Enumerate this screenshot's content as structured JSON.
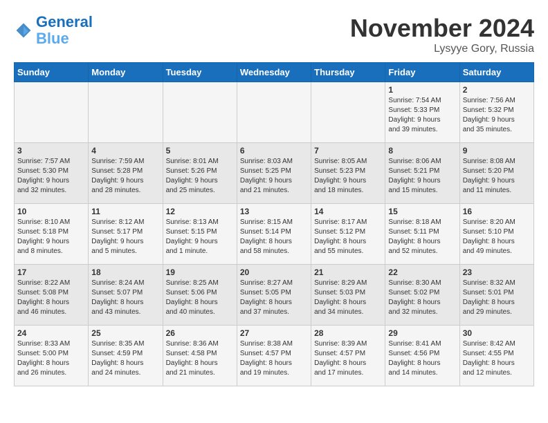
{
  "header": {
    "logo_line1": "General",
    "logo_line2": "Blue",
    "month_title": "November 2024",
    "location": "Lysyye Gory, Russia"
  },
  "weekdays": [
    "Sunday",
    "Monday",
    "Tuesday",
    "Wednesday",
    "Thursday",
    "Friday",
    "Saturday"
  ],
  "weeks": [
    [
      {
        "day": "",
        "info": ""
      },
      {
        "day": "",
        "info": ""
      },
      {
        "day": "",
        "info": ""
      },
      {
        "day": "",
        "info": ""
      },
      {
        "day": "",
        "info": ""
      },
      {
        "day": "1",
        "info": "Sunrise: 7:54 AM\nSunset: 5:33 PM\nDaylight: 9 hours\nand 39 minutes."
      },
      {
        "day": "2",
        "info": "Sunrise: 7:56 AM\nSunset: 5:32 PM\nDaylight: 9 hours\nand 35 minutes."
      }
    ],
    [
      {
        "day": "3",
        "info": "Sunrise: 7:57 AM\nSunset: 5:30 PM\nDaylight: 9 hours\nand 32 minutes."
      },
      {
        "day": "4",
        "info": "Sunrise: 7:59 AM\nSunset: 5:28 PM\nDaylight: 9 hours\nand 28 minutes."
      },
      {
        "day": "5",
        "info": "Sunrise: 8:01 AM\nSunset: 5:26 PM\nDaylight: 9 hours\nand 25 minutes."
      },
      {
        "day": "6",
        "info": "Sunrise: 8:03 AM\nSunset: 5:25 PM\nDaylight: 9 hours\nand 21 minutes."
      },
      {
        "day": "7",
        "info": "Sunrise: 8:05 AM\nSunset: 5:23 PM\nDaylight: 9 hours\nand 18 minutes."
      },
      {
        "day": "8",
        "info": "Sunrise: 8:06 AM\nSunset: 5:21 PM\nDaylight: 9 hours\nand 15 minutes."
      },
      {
        "day": "9",
        "info": "Sunrise: 8:08 AM\nSunset: 5:20 PM\nDaylight: 9 hours\nand 11 minutes."
      }
    ],
    [
      {
        "day": "10",
        "info": "Sunrise: 8:10 AM\nSunset: 5:18 PM\nDaylight: 9 hours\nand 8 minutes."
      },
      {
        "day": "11",
        "info": "Sunrise: 8:12 AM\nSunset: 5:17 PM\nDaylight: 9 hours\nand 5 minutes."
      },
      {
        "day": "12",
        "info": "Sunrise: 8:13 AM\nSunset: 5:15 PM\nDaylight: 9 hours\nand 1 minute."
      },
      {
        "day": "13",
        "info": "Sunrise: 8:15 AM\nSunset: 5:14 PM\nDaylight: 8 hours\nand 58 minutes."
      },
      {
        "day": "14",
        "info": "Sunrise: 8:17 AM\nSunset: 5:12 PM\nDaylight: 8 hours\nand 55 minutes."
      },
      {
        "day": "15",
        "info": "Sunrise: 8:18 AM\nSunset: 5:11 PM\nDaylight: 8 hours\nand 52 minutes."
      },
      {
        "day": "16",
        "info": "Sunrise: 8:20 AM\nSunset: 5:10 PM\nDaylight: 8 hours\nand 49 minutes."
      }
    ],
    [
      {
        "day": "17",
        "info": "Sunrise: 8:22 AM\nSunset: 5:08 PM\nDaylight: 8 hours\nand 46 minutes."
      },
      {
        "day": "18",
        "info": "Sunrise: 8:24 AM\nSunset: 5:07 PM\nDaylight: 8 hours\nand 43 minutes."
      },
      {
        "day": "19",
        "info": "Sunrise: 8:25 AM\nSunset: 5:06 PM\nDaylight: 8 hours\nand 40 minutes."
      },
      {
        "day": "20",
        "info": "Sunrise: 8:27 AM\nSunset: 5:05 PM\nDaylight: 8 hours\nand 37 minutes."
      },
      {
        "day": "21",
        "info": "Sunrise: 8:29 AM\nSunset: 5:03 PM\nDaylight: 8 hours\nand 34 minutes."
      },
      {
        "day": "22",
        "info": "Sunrise: 8:30 AM\nSunset: 5:02 PM\nDaylight: 8 hours\nand 32 minutes."
      },
      {
        "day": "23",
        "info": "Sunrise: 8:32 AM\nSunset: 5:01 PM\nDaylight: 8 hours\nand 29 minutes."
      }
    ],
    [
      {
        "day": "24",
        "info": "Sunrise: 8:33 AM\nSunset: 5:00 PM\nDaylight: 8 hours\nand 26 minutes."
      },
      {
        "day": "25",
        "info": "Sunrise: 8:35 AM\nSunset: 4:59 PM\nDaylight: 8 hours\nand 24 minutes."
      },
      {
        "day": "26",
        "info": "Sunrise: 8:36 AM\nSunset: 4:58 PM\nDaylight: 8 hours\nand 21 minutes."
      },
      {
        "day": "27",
        "info": "Sunrise: 8:38 AM\nSunset: 4:57 PM\nDaylight: 8 hours\nand 19 minutes."
      },
      {
        "day": "28",
        "info": "Sunrise: 8:39 AM\nSunset: 4:57 PM\nDaylight: 8 hours\nand 17 minutes."
      },
      {
        "day": "29",
        "info": "Sunrise: 8:41 AM\nSunset: 4:56 PM\nDaylight: 8 hours\nand 14 minutes."
      },
      {
        "day": "30",
        "info": "Sunrise: 8:42 AM\nSunset: 4:55 PM\nDaylight: 8 hours\nand 12 minutes."
      }
    ]
  ]
}
